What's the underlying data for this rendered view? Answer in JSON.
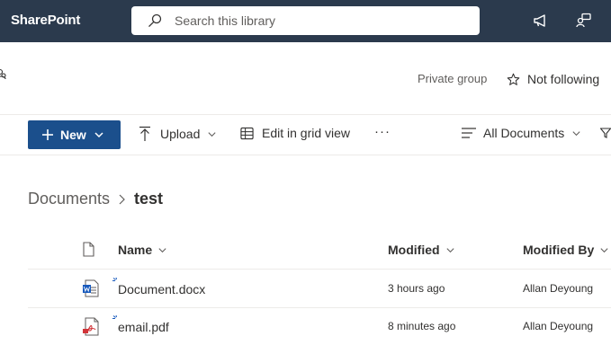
{
  "suitebar": {
    "brand": "SharePoint",
    "search_placeholder": "Search this library",
    "icons": [
      "search-icon",
      "megaphone-icon",
      "feedback-icon"
    ]
  },
  "site_header": {
    "privacy": "Private group",
    "follow_label": "Not following"
  },
  "commandbar": {
    "new_label": "New",
    "upload_label": "Upload",
    "grid_label": "Edit in grid view",
    "more_label": "···",
    "view_label": "All Documents"
  },
  "breadcrumb": {
    "parent": "Documents",
    "current": "test"
  },
  "table": {
    "columns": {
      "name": "Name",
      "modified": "Modified",
      "modified_by": "Modified By"
    },
    "rows": [
      {
        "name": "Document.docx",
        "type_icon": "word-doc-icon",
        "modified": "3 hours ago",
        "modified_by": "Allan Deyoung"
      },
      {
        "name": "email.pdf",
        "type_icon": "pdf-icon",
        "modified": "8 minutes ago",
        "modified_by": "Allan Deyoung"
      }
    ]
  },
  "colors": {
    "suitebar_bg": "#2b3a4d",
    "primary_button": "#1b4f8c",
    "word_blue": "#185abd",
    "pdf_red": "#d13438"
  }
}
